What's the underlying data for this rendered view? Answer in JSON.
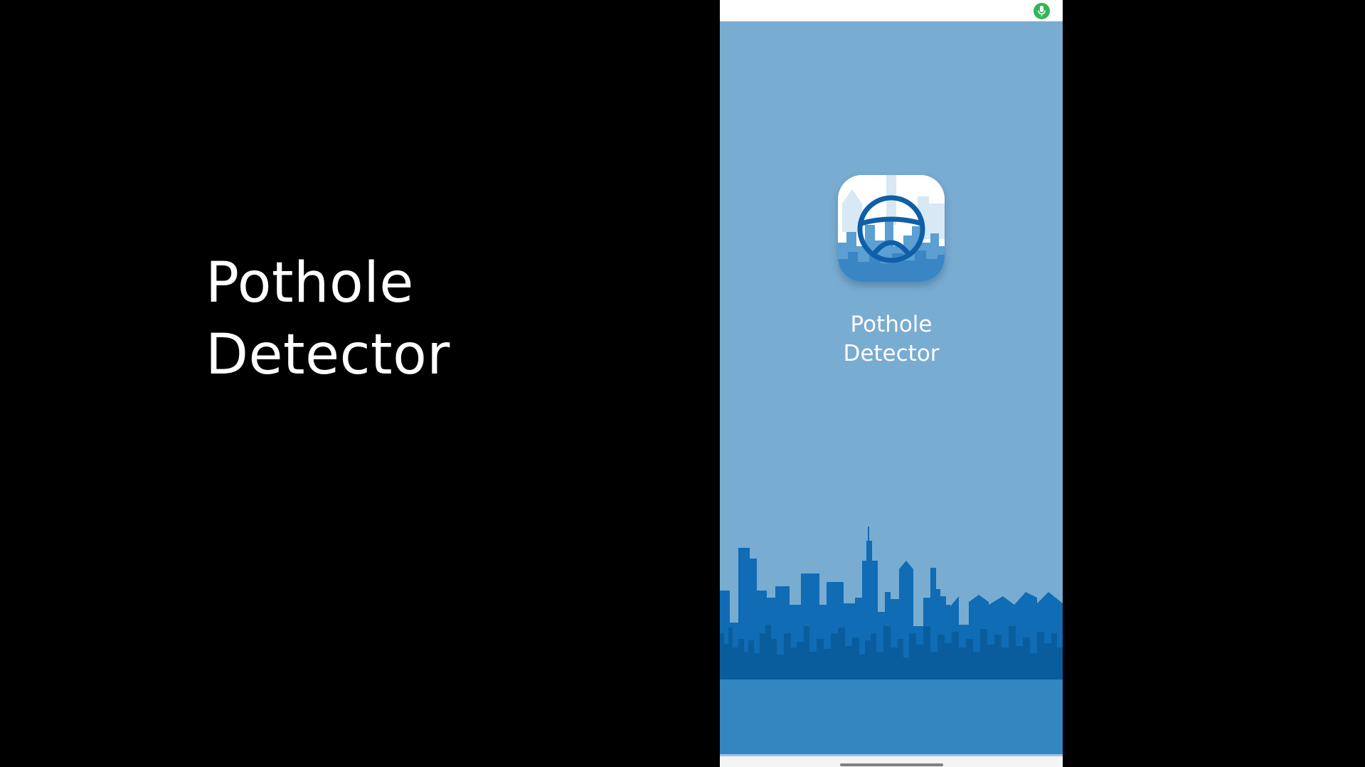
{
  "slide": {
    "title_line1": "Pothole",
    "title_line2": "Detector"
  },
  "phone": {
    "status_bar": {
      "indicator_icon": "microphone-icon",
      "indicator_color": "#34b45a"
    },
    "splash": {
      "app_icon": "steering-wheel-city-icon",
      "app_name_line1": "Pothole",
      "app_name_line2": "Detector",
      "background_color": "#79acd1",
      "skyline_color": "#0f6cb5",
      "ground_color": "#3486c0"
    }
  }
}
